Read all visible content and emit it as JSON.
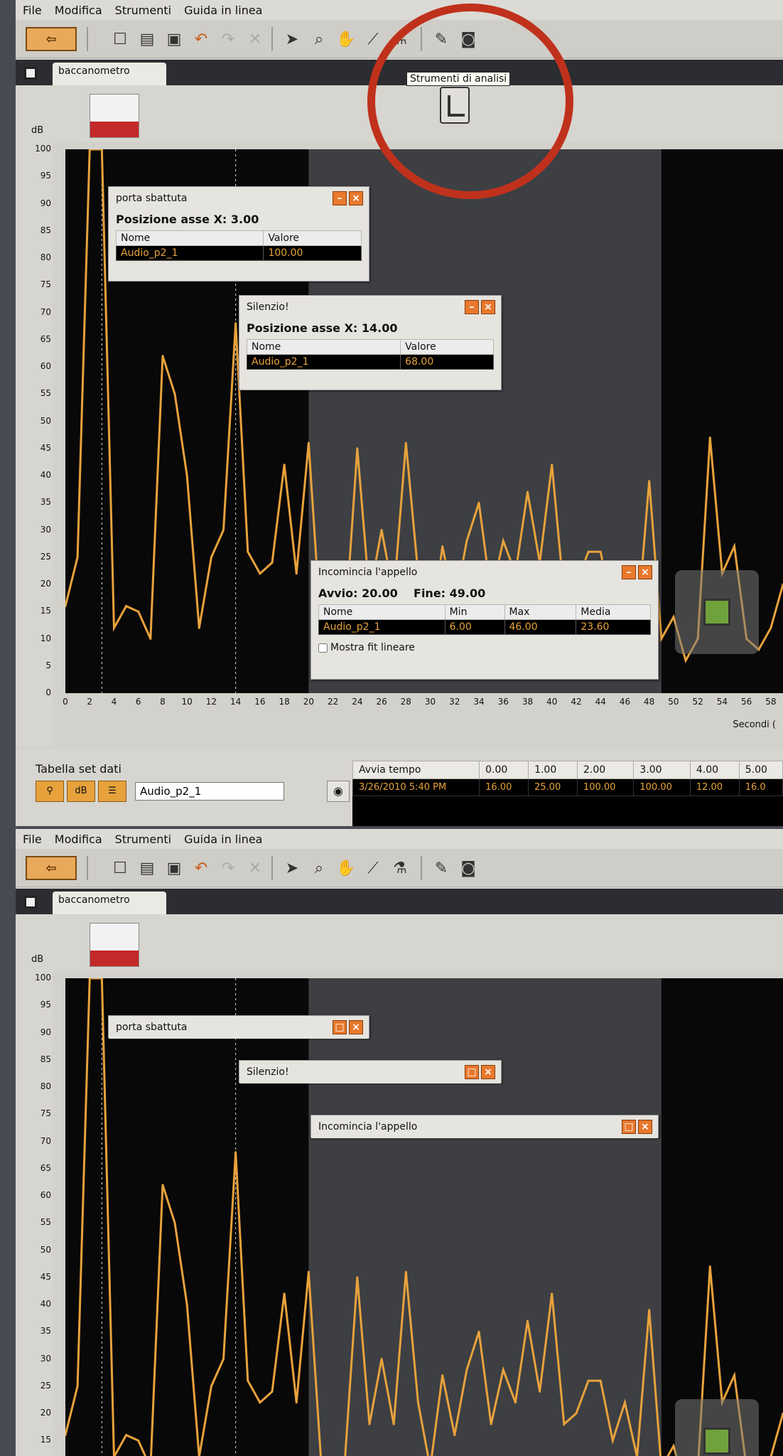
{
  "menu": [
    "File",
    "Modifica",
    "Strumenti",
    "Guida in linea"
  ],
  "tooltip": "Strumenti di analisi",
  "tab": {
    "label": "baccanometro"
  },
  "yaxis": {
    "unit": "dB",
    "ticks": [
      "100",
      "95",
      "90",
      "85",
      "80",
      "75",
      "70",
      "65",
      "60",
      "55",
      "50",
      "45",
      "40",
      "35",
      "30",
      "25",
      "20",
      "15",
      "10",
      "5",
      "0"
    ]
  },
  "xaxis": {
    "label": "Secondi (",
    "ticks": [
      "0",
      "2",
      "4",
      "6",
      "8",
      "10",
      "12",
      "14",
      "16",
      "18",
      "20",
      "22",
      "24",
      "26",
      "28",
      "30",
      "32",
      "34",
      "36",
      "38",
      "40",
      "42",
      "44",
      "46",
      "48",
      "50",
      "52",
      "54",
      "56",
      "58"
    ]
  },
  "panel_porta": {
    "title": "porta sbattuta",
    "subtitle": "Posizione asse X: 3.00",
    "col_nome": "Nome",
    "col_valore": "Valore",
    "row_nome": "Audio_p2_1",
    "row_valore": "100.00"
  },
  "panel_silenzio": {
    "title": "Silenzio!",
    "subtitle": "Posizione asse X: 14.00",
    "col_nome": "Nome",
    "col_valore": "Valore",
    "row_nome": "Audio_p2_1",
    "row_valore": "68.00"
  },
  "panel_appello": {
    "title": "Incomincia l'appello",
    "avvio": "Avvio: 20.00",
    "fine": "Fine: 49.00",
    "col_nome": "Nome",
    "col_min": "Min",
    "col_max": "Max",
    "col_media": "Media",
    "row_nome": "Audio_p2_1",
    "row_min": "6.00",
    "row_max": "46.00",
    "row_media": "23.60",
    "checkbox": "Mostra fit lineare"
  },
  "dataset": {
    "label": "Tabella set dati",
    "unit_btn": "dB",
    "series_name": "Audio_p2_1",
    "headers": [
      "Avvia tempo",
      "0.00",
      "1.00",
      "2.00",
      "3.00",
      "4.00",
      "5.00"
    ],
    "row": [
      "3/26/2010 5:40 PM",
      "16.00",
      "25.00",
      "100.00",
      "100.00",
      "12.00",
      "16.0"
    ]
  },
  "colors": {
    "trace": "#e8a23c",
    "accent": "#e8792d",
    "highlight_circle": "#c0311c"
  },
  "chart_data": {
    "type": "line",
    "xlabel": "Secondi",
    "ylabel": "dB",
    "xlim": [
      0,
      59
    ],
    "ylim": [
      0,
      100
    ],
    "series": [
      {
        "name": "Audio_p2_1",
        "x": [
          0,
          1,
          2,
          3,
          4,
          5,
          6,
          7,
          8,
          9,
          10,
          11,
          12,
          13,
          14,
          15,
          16,
          17,
          18,
          19,
          20,
          21,
          22,
          23,
          24,
          25,
          26,
          27,
          28,
          29,
          30,
          31,
          32,
          33,
          34,
          35,
          36,
          37,
          38,
          39,
          40,
          41,
          42,
          43,
          44,
          45,
          46,
          47,
          48,
          49,
          50,
          51,
          52,
          53,
          54,
          55,
          56,
          57,
          58,
          59
        ],
        "y": [
          16,
          25,
          100,
          100,
          12,
          16,
          15,
          10,
          62,
          55,
          40,
          12,
          25,
          30,
          68,
          26,
          22,
          24,
          42,
          22,
          46,
          12,
          10,
          12,
          45,
          18,
          30,
          18,
          46,
          22,
          10,
          27,
          16,
          28,
          35,
          18,
          28,
          22,
          37,
          24,
          42,
          18,
          20,
          26,
          26,
          15,
          22,
          12,
          39,
          10,
          14,
          6,
          10,
          47,
          22,
          27,
          10,
          8,
          12,
          20
        ]
      }
    ],
    "regions": [
      {
        "name": "Incomincia l'appello",
        "start": 20,
        "end": 49
      }
    ],
    "markers": [
      {
        "name": "porta sbattuta",
        "x": 3
      },
      {
        "name": "Silenzio!",
        "x": 14
      }
    ]
  }
}
